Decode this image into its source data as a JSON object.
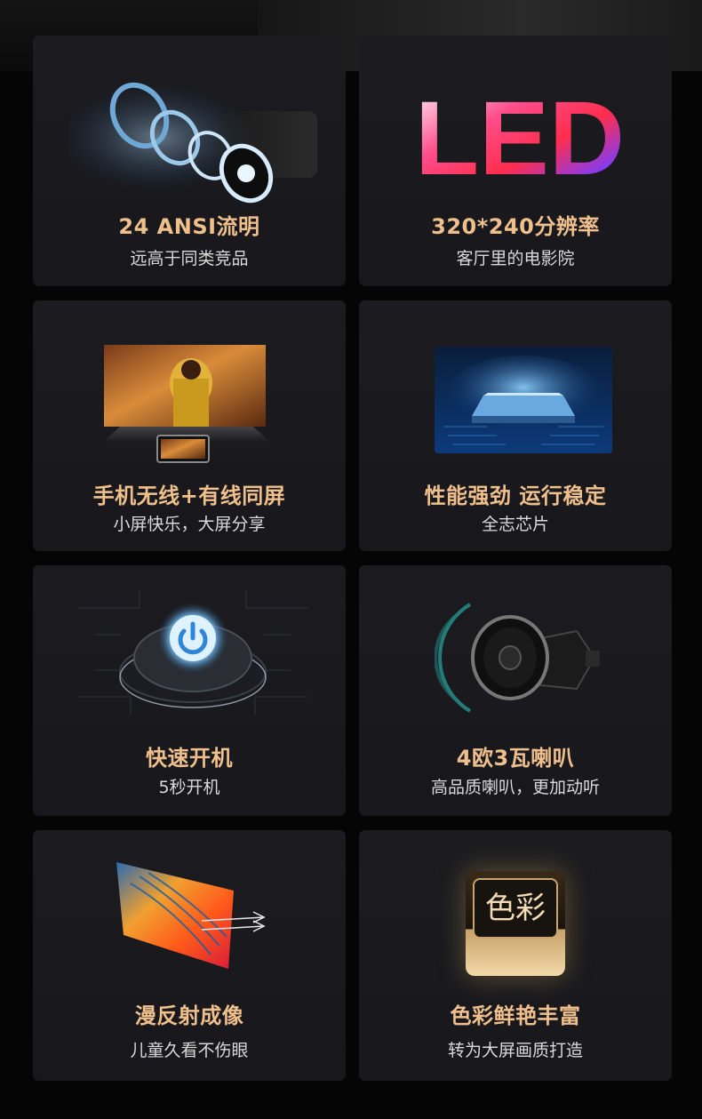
{
  "cards": [
    {
      "title": "24 ANSI流明",
      "subtitle": "远高于同类竞品",
      "icon": "projector-lens-icon"
    },
    {
      "title": "320*240分辨率",
      "subtitle": "客厅里的电影院",
      "icon": "led-text-icon",
      "logo_text": "LED"
    },
    {
      "title": "手机无线+有线同屏",
      "subtitle": "小屏快乐，大屏分享",
      "icon": "screen-mirroring-icon"
    },
    {
      "title": "性能强劲 运行稳定",
      "subtitle": "全志芯片",
      "icon": "chip-icon"
    },
    {
      "title": "快速开机",
      "subtitle": "5秒开机",
      "icon": "power-button-icon"
    },
    {
      "title": "4欧3瓦喇叭",
      "subtitle": "高品质喇叭，更加动听",
      "icon": "speaker-icon"
    },
    {
      "title": "漫反射成像",
      "subtitle": "儿童久看不伤眼",
      "icon": "diffuse-reflection-screen-icon"
    },
    {
      "title": "色彩鲜艳丰富",
      "subtitle": "转为大屏画质打造",
      "icon": "color-badge-icon",
      "badge_text": "色彩"
    }
  ],
  "colors": {
    "accent": "#f0c08c",
    "card_bg": "#1c1c20",
    "page_bg": "#050505",
    "subtitle": "#d9d9d9"
  }
}
